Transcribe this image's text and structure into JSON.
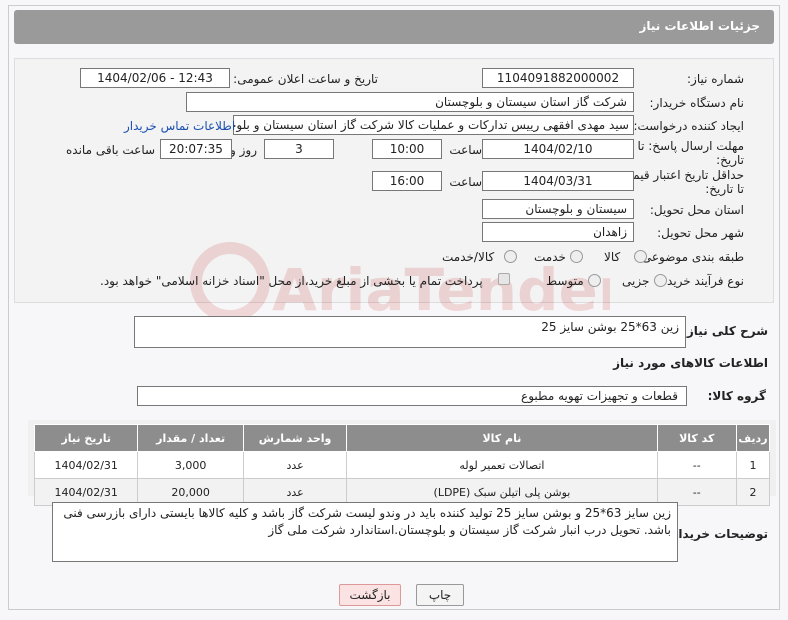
{
  "header": {
    "title": "جزئیات اطلاعات نیاز"
  },
  "form": {
    "need_number_label": "شماره نیاز:",
    "need_number": "1104091882000002",
    "announce_label": "تاریخ و ساعت اعلان عمومی:",
    "announce_value": "1404/02/06 - 12:43",
    "buyer_org_label": "نام دستگاه خریدار:",
    "buyer_org": "شرکت گاز استان سیستان و بلوچستان",
    "creator_label": "ایجاد کننده درخواست:",
    "creator": "سید مهدی افقهی رییس تدارکات و عملیات کالا شرکت گاز استان سیستان و بلوچستان",
    "contact_link": "اطلاعات تماس خریدار",
    "reply_deadline_label": "مهلت ارسال پاسخ: تا تاریخ:",
    "reply_date": "1404/02/10",
    "time_label": "ساعت",
    "reply_time": "10:00",
    "days_value": "3",
    "days_label": "روز و",
    "remaining_time": "20:07:35",
    "remaining_label": "ساعت باقی مانده",
    "price_deadline_label": "حداقل تاریخ اعتبار قیمت: تا تاریخ:",
    "price_date": "1404/03/31",
    "price_time": "16:00",
    "province_label": "استان محل تحویل:",
    "province": "سیستان و بلوچستان",
    "city_label": "شهر محل تحویل:",
    "city": "زاهدان",
    "category_label": "طبقه بندی موضوعی:",
    "category_options": [
      "کالا",
      "خدمت",
      "کالا/خدمت"
    ],
    "process_label": "نوع فرآیند خرید :",
    "process_options": [
      "جزیی",
      "متوسط"
    ],
    "payment_note": "پرداخت تمام یا بخشی از مبلغ خرید،از محل \"اسناد خزانه اسلامی\" خواهد بود."
  },
  "description": {
    "label": "شرح کلی نیاز:",
    "value": "زین 63*25 بوشن سایز 25"
  },
  "goods": {
    "section_title": "اطلاعات کالاهای مورد نیاز",
    "group_label": "گروه کالا:",
    "group_value": "قطعات و تجهیزات تهویه مطبوع",
    "columns": [
      "ردیف",
      "کد کالا",
      "نام کالا",
      "واحد شمارش",
      "تعداد / مقدار",
      "تاریخ نیاز"
    ],
    "rows": [
      [
        "1",
        "--",
        "اتصالات تعمیر لوله",
        "عدد",
        "3,000",
        "1404/02/31"
      ],
      [
        "2",
        "--",
        "بوشن پلی اتیلن سبک (LDPE)",
        "عدد",
        "20,000",
        "1404/02/31"
      ]
    ]
  },
  "buyer_notes": {
    "label": "توضیحات خریدار:",
    "value": "زین سایز 63*25 و بوشن سایز 25 تولید کننده باید در وندو لیست شرکت گاز باشد و کلیه کالاها بایستی دارای بازرسی فنی باشد. تحویل درب انبار شرکت گاز سیستان و بلوچستان.استاندارد شرکت ملی گاز"
  },
  "buttons": {
    "print": "چاپ",
    "back": "بازگشت"
  },
  "watermark": "AriaTender.net"
}
